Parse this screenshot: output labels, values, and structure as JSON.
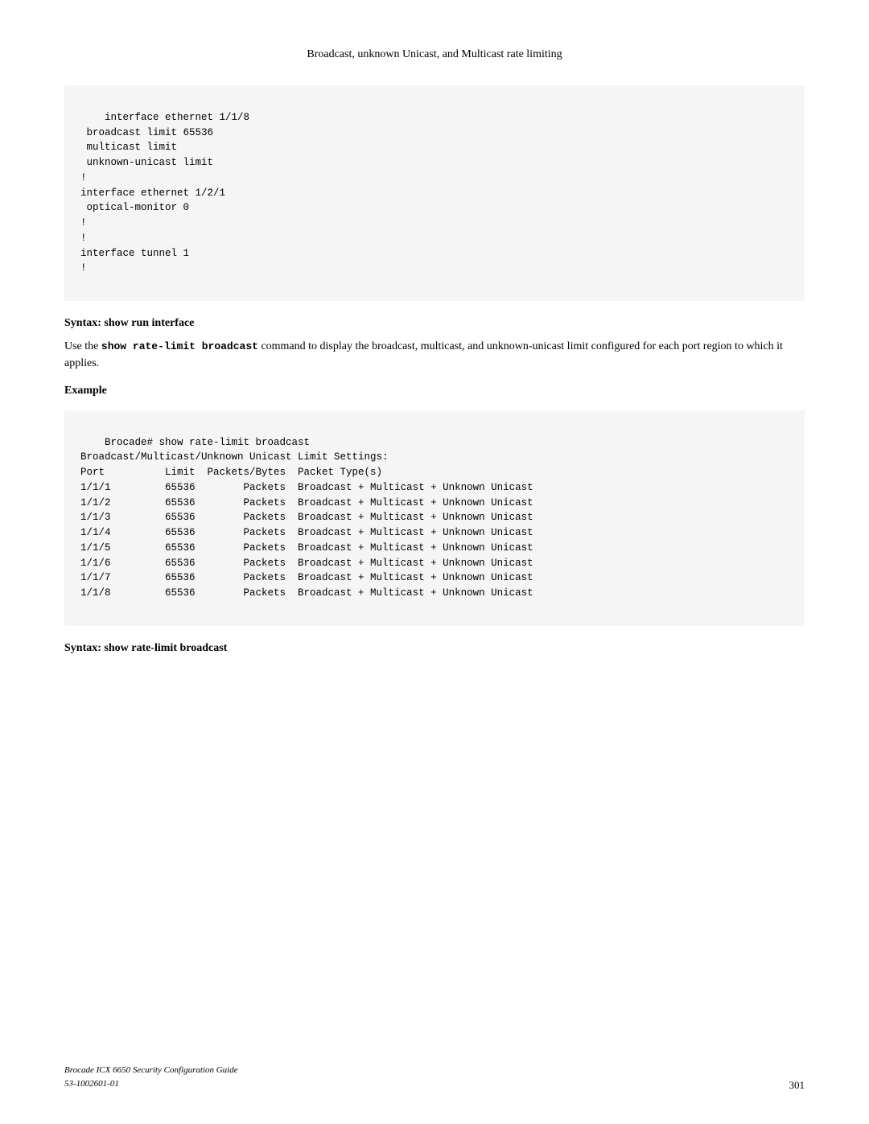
{
  "header": {
    "title": "Broadcast, unknown Unicast, and Multicast rate limiting"
  },
  "code_block_1": {
    "content": "interface ethernet 1/1/8\n broadcast limit 65536\n multicast limit\n unknown-unicast limit\n!\ninterface ethernet 1/2/1\n optical-monitor 0\n!\n!\ninterface tunnel 1\n!"
  },
  "syntax_1": {
    "heading": "Syntax:  show run interface"
  },
  "body_paragraph": {
    "text_before": "Use the ",
    "bold_command": "show rate-limit broadcast",
    "text_after": " command to display the broadcast, multicast, and unknown-unicast limit configured for each port region to which it applies."
  },
  "example_label": {
    "text": "Example"
  },
  "code_block_2": {
    "content": "Brocade# show rate-limit broadcast\nBroadcast/Multicast/Unknown Unicast Limit Settings:\nPort          Limit  Packets/Bytes  Packet Type(s)\n1/1/1         65536        Packets  Broadcast + Multicast + Unknown Unicast\n1/1/2         65536        Packets  Broadcast + Multicast + Unknown Unicast\n1/1/3         65536        Packets  Broadcast + Multicast + Unknown Unicast\n1/1/4         65536        Packets  Broadcast + Multicast + Unknown Unicast\n1/1/5         65536        Packets  Broadcast + Multicast + Unknown Unicast\n1/1/6         65536        Packets  Broadcast + Multicast + Unknown Unicast\n1/1/7         65536        Packets  Broadcast + Multicast + Unknown Unicast\n1/1/8         65536        Packets  Broadcast + Multicast + Unknown Unicast"
  },
  "syntax_2": {
    "heading": "Syntax:  show rate-limit broadcast"
  },
  "footer": {
    "left_line1": "Brocade ICX 6650 Security Configuration Guide",
    "left_line2": "53-1002601-01",
    "page_number": "301"
  }
}
